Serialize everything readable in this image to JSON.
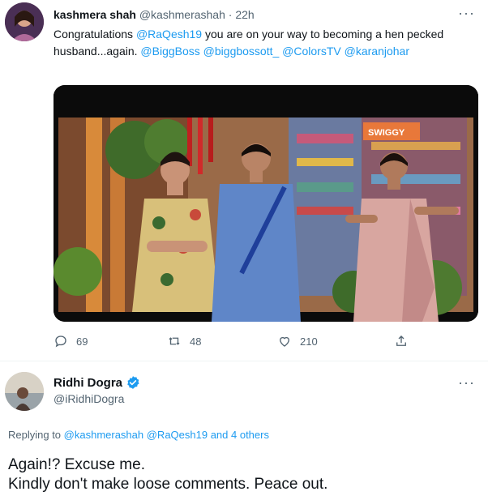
{
  "tweet": {
    "author_name": "kashmera shah",
    "author_handle": "@kashmerashah",
    "separator": "·",
    "time": "22h",
    "more": "···",
    "text_parts": {
      "p1": "Congratulations ",
      "m1": "@RaQesh19",
      "p2": " you are on your way to becoming a hen pecked husband...again. ",
      "m2": "@BiggBoss",
      "p3": " ",
      "m3": "@biggbossott_",
      "p4": " ",
      "m4": "@ColorsTV",
      "p5": " ",
      "m5": "@karanjohar"
    },
    "media_sign": "SWIGGY",
    "replies": "69",
    "retweets": "48",
    "likes": "210"
  },
  "reply_tweet": {
    "author_name": "Ridhi Dogra",
    "author_handle": "@iRidhiDogra",
    "more": "···",
    "replying_prefix": "Replying to ",
    "replying_to": "@kashmerashah @RaQesh19 and 4 others",
    "line1": "Again!? Excuse me.",
    "line2": "Kindly don't make loose comments. Peace out."
  },
  "colors": {
    "accent": "#1d9bf0",
    "muted": "#536471",
    "verified": "#1d9bf0"
  },
  "icons": [
    "reply-icon",
    "retweet-icon",
    "like-icon",
    "share-icon",
    "verified-badge-icon",
    "more-icon"
  ]
}
